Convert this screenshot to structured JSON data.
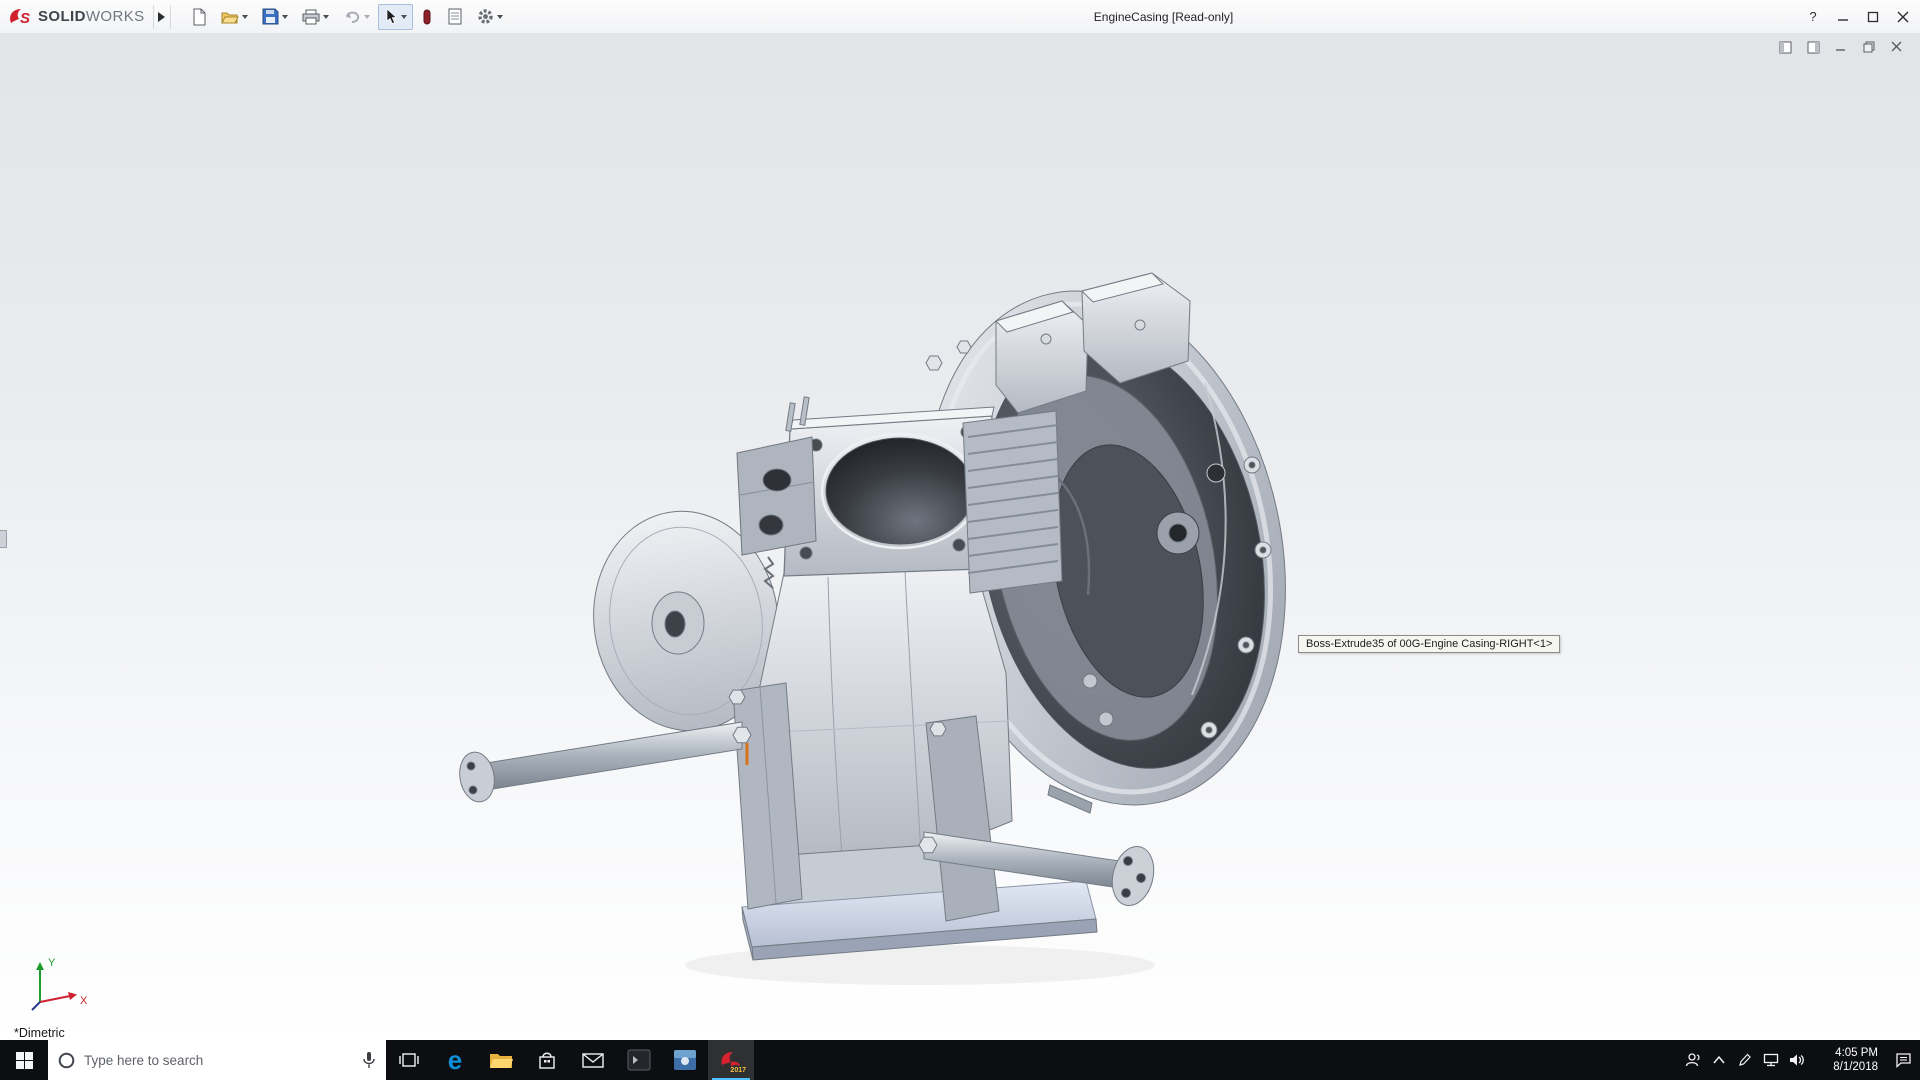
{
  "window": {
    "title": "EngineCasing [Read-only]",
    "brand": {
      "solid": "SOLID",
      "works": "WORKS"
    },
    "controls": {
      "help": "?"
    }
  },
  "toolbar": {
    "icons": [
      "new-document",
      "open",
      "save",
      "print",
      "undo",
      "select-arrow",
      "instant3d-toggle",
      "design-library",
      "options"
    ]
  },
  "viewport": {
    "tooltip": "Boss-Extrude35 of 00G-Engine Casing-RIGHT<1>",
    "view_orientation": "*Dimetric",
    "triad": {
      "x": "X",
      "y": "Y"
    }
  },
  "taskbar": {
    "search_placeholder": "Type here to search",
    "edge_glyph": "e",
    "solidworks_badge": "2017",
    "clock": {
      "time": "4:05 PM",
      "date": "8/1/2018"
    },
    "apps": [
      "task-view",
      "microsoft-edge",
      "file-explorer",
      "microsoft-store",
      "mail",
      "terminal",
      "solidworks-tools",
      "solidworks-2017"
    ]
  },
  "colors": {
    "accent_red": "#cf202f",
    "taskbar_bg": "#0c0e11"
  }
}
